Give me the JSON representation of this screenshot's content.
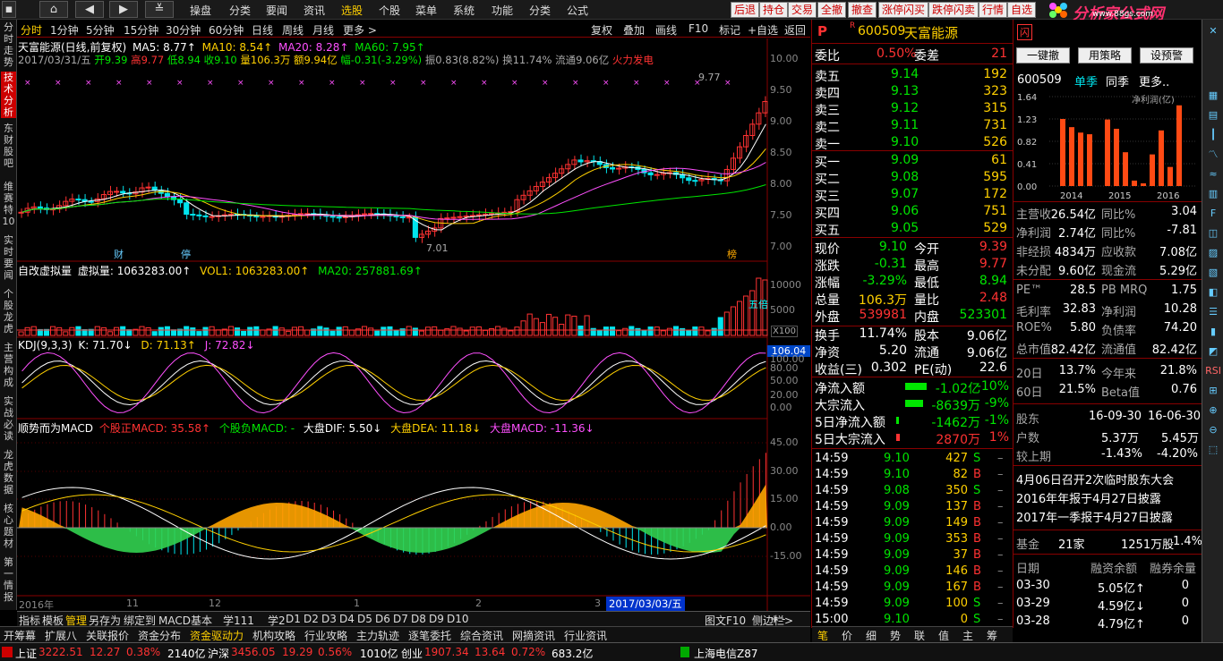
{
  "menubar": {
    "nav_icons": [
      "home-icon",
      "back-icon",
      "forward-icon",
      "menu-fold-icon"
    ],
    "items": [
      "操盘",
      "分类",
      "要闻",
      "资讯",
      "选股",
      "个股",
      "菜单",
      "系统",
      "功能",
      "分类",
      "公式"
    ],
    "active_index": 4,
    "quick_buttons": [
      "后退",
      "持仓",
      "交易",
      "全撤",
      "撤查",
      "涨停闪买",
      "跌停闪卖",
      "行情",
      "自选"
    ],
    "logo_text": "分析家公式网",
    "logo_url": "www.88gs.com"
  },
  "leftbar": [
    "分时走势",
    "技术分析",
    "东财股吧",
    "维赛特10",
    "实时要闻",
    "个股龙虎",
    "主营构成",
    "实战必读",
    "龙虎数据",
    "核心题材",
    "第一情报"
  ],
  "leftbar_active": 1,
  "periodbar": {
    "tabs": [
      "分时",
      "1分钟",
      "5分钟",
      "15分钟",
      "30分钟",
      "60分钟",
      "日线",
      "周线",
      "月线",
      "更多 >"
    ],
    "active_index": 0,
    "tools": [
      "复权",
      "叠加",
      "画线",
      "F10",
      "标记",
      "+自选",
      "返回"
    ]
  },
  "kline": {
    "title": "天富能源(日线,前复权)",
    "ma5": "MA5: 8.77↑",
    "ma10": "MA10: 8.54↑",
    "ma20": "MA20: 8.28↑",
    "ma60": "MA60: 7.95↑",
    "info_date": "2017/03/31/五",
    "info_open": "开9.39",
    "info_high": "高9.77",
    "info_low": "低8.94",
    "info_close": "收9.10",
    "info_vol": "量106.3万",
    "info_amt": "额9.94亿",
    "info_chg": "幅-0.31(-3.29%)",
    "info_amp": "振0.83(8.82%)",
    "info_turn": "换11.74%",
    "info_float": "流通9.06亿",
    "info_concept": "火力发电",
    "high_label": "9.77",
    "low_label": "7.01",
    "mark_cai": "财",
    "mark_ting": "停",
    "mark_bang": "榜",
    "yticks": [
      "10.00",
      "9.50",
      "9.00",
      "8.50",
      "8.00",
      "7.50",
      "7.00"
    ]
  },
  "vol": {
    "title": "自改虚拟量",
    "virtual": "虚拟量: 1063283.00↑",
    "vol1": "VOL1: 1063283.00↑",
    "ma20": "MA20: 257881.69↑",
    "yticks": [
      "10000",
      "5000"
    ],
    "unit": "X100",
    "marker": "五倍",
    "side_value": "106.04"
  },
  "kdj": {
    "title": "KDJ(9,3,3)",
    "k": "K: 71.70↓",
    "d": "D: 71.13↑",
    "j": "J: 72.82↓",
    "yticks": [
      "100.00",
      "80.00",
      "50.00",
      "20.00",
      "0.00"
    ]
  },
  "macd": {
    "title": "顺势而为MACD",
    "stock_pos": "个股正MACD: 35.58↑",
    "stock_neg": "个股负MACD: -",
    "dif": "大盘DIF: 5.50↓",
    "dea": "大盘DEA: 11.18↓",
    "mmacd": "大盘MACD: -11.36↓",
    "yticks": [
      "45.00",
      "30.00",
      "15.00",
      "0.00",
      "-15.00"
    ]
  },
  "xaxis": {
    "labels": [
      "2016年",
      "11",
      "12",
      "1",
      "2",
      "3"
    ],
    "cursor": "2017/03/03/五"
  },
  "bottom_tabs": [
    "指标",
    "模板",
    "管理",
    "另存为",
    "绑定到",
    "MACD基本",
    "学111",
    "学2",
    "D1",
    "D2",
    "D3",
    "D4",
    "D5",
    "D6",
    "D7",
    "D8",
    "D9",
    "D10"
  ],
  "bottom_tabs_active": 2,
  "bottom_right": [
    "+",
    "-",
    "图文F10",
    "侧边栏>"
  ],
  "bottom_tabs2": [
    "开筹幕",
    "扩展八",
    "关联报价",
    "资金分布",
    "资金驱动力",
    "机构攻略",
    "行业攻略",
    "主力轨迹",
    "逐笔委托",
    "综合资讯",
    "网摘资讯",
    "行业资讯"
  ],
  "bottom_tabs2_active": 4,
  "status": {
    "sh_label": "上证",
    "sh_val": "3222.51",
    "sh_chg": "12.27",
    "sh_pct": "0.38%",
    "sh_amt": "2140亿",
    "sz_label": "沪深",
    "sz_val": "3456.05",
    "sz_chg": "19.29",
    "sz_pct": "0.56%",
    "sz_amt": "1010亿",
    "cy_label": "创业",
    "cy_val": "1907.34",
    "cy_chg": "13.64",
    "cy_pct": "0.72%",
    "cy_amt": "683.2亿",
    "net": "上海电信Z87"
  },
  "quote": {
    "p_mark": "P",
    "r_mark": "R",
    "code": "600509",
    "name": "天富能源",
    "wb_label": "委比",
    "wb": "0.50%",
    "wc_label": "委差",
    "wc": "21",
    "asks": [
      [
        "卖五",
        "9.14",
        "192"
      ],
      [
        "卖四",
        "9.13",
        "323"
      ],
      [
        "卖三",
        "9.12",
        "315"
      ],
      [
        "卖二",
        "9.11",
        "731"
      ],
      [
        "卖一",
        "9.10",
        "526"
      ]
    ],
    "bids": [
      [
        "买一",
        "9.09",
        "61"
      ],
      [
        "买二",
        "9.08",
        "595"
      ],
      [
        "买三",
        "9.07",
        "172"
      ],
      [
        "买四",
        "9.06",
        "751"
      ],
      [
        "买五",
        "9.05",
        "529"
      ]
    ],
    "stats": [
      [
        "现价",
        "9.10",
        "今开",
        "9.39"
      ],
      [
        "涨跌",
        "-0.31",
        "最高",
        "9.77"
      ],
      [
        "涨幅",
        "-3.29%",
        "最低",
        "8.94"
      ],
      [
        "总量",
        "106.3万",
        "量比",
        "2.48"
      ],
      [
        "外盘",
        "539981",
        "内盘",
        "523301"
      ]
    ],
    "stats2": [
      [
        "换手",
        "11.74%",
        "股本",
        "9.06亿"
      ],
      [
        "净资",
        "5.20",
        "流通",
        "9.06亿"
      ],
      [
        "收益(三)",
        "0.302",
        "PE(动)",
        "22.6"
      ]
    ],
    "flows": [
      [
        "净流入额",
        "-1.02亿",
        "-10%"
      ],
      [
        "大宗流入",
        "-8639万",
        "-9%"
      ],
      [
        "5日净流入额",
        "-1462万",
        "-1%"
      ],
      [
        "5日大宗流入",
        "2870万",
        "1%"
      ]
    ],
    "ticks": [
      [
        "14:59",
        "9.10",
        "427",
        "S"
      ],
      [
        "14:59",
        "9.10",
        "82",
        "B"
      ],
      [
        "14:59",
        "9.08",
        "350",
        "S"
      ],
      [
        "14:59",
        "9.09",
        "137",
        "B"
      ],
      [
        "14:59",
        "9.09",
        "149",
        "B"
      ],
      [
        "14:59",
        "9.09",
        "353",
        "B"
      ],
      [
        "14:59",
        "9.09",
        "37",
        "B"
      ],
      [
        "14:59",
        "9.09",
        "146",
        "B"
      ],
      [
        "14:59",
        "9.09",
        "167",
        "B"
      ],
      [
        "14:59",
        "9.09",
        "100",
        "S"
      ],
      [
        "15:00",
        "9.10",
        "0",
        "S"
      ]
    ],
    "tabs": [
      "笔",
      "价",
      "细",
      "势",
      "联",
      "值",
      "主",
      "筹"
    ]
  },
  "f10": {
    "tabs": [
      "闪"
    ],
    "buttons": [
      "一键撤",
      "用策略",
      "设预警"
    ],
    "code": "600509",
    "mode1": "单季",
    "mode2": "同季",
    "more": "更多..",
    "chart_label": "净利润(亿)",
    "yticks": [
      "1.64",
      "1.23",
      "0.82",
      "0.41",
      "0.00"
    ],
    "years": [
      "2014",
      "2015",
      "2016"
    ],
    "rows": [
      [
        "主营收",
        "26.54亿",
        "同比%",
        "3.04"
      ],
      [
        "净利润",
        "2.74亿",
        "同比%",
        "-7.81"
      ],
      [
        "非经损",
        "4834万",
        "应收款",
        "7.08亿"
      ],
      [
        "未分配",
        "9.60亿",
        "现金流",
        "5.29亿"
      ]
    ],
    "rows2": [
      [
        "PE™",
        "28.5",
        "PB MRQ",
        "1.75"
      ],
      [
        "毛利率",
        "32.83",
        "净利润",
        "10.28"
      ],
      [
        "ROE%",
        "5.80",
        "负债率",
        "74.20"
      ],
      [
        "总市值",
        "82.42亿",
        "流通值",
        "82.42亿"
      ]
    ],
    "rows3": [
      [
        "20日",
        "13.7%",
        "今年来",
        "21.8%"
      ],
      [
        "60日",
        "21.5%",
        "Beta值",
        "0.76"
      ]
    ],
    "holders_label": "股东",
    "holders_d1": "16-09-30",
    "holders_d2": "16-06-30",
    "hu_label": "户数",
    "hu_v1": "5.37万",
    "hu_v2": "5.45万",
    "hq_label": "较上期",
    "hq_v1": "-1.43%",
    "hq_v2": "-4.20%",
    "notes": [
      "4月06日召开2次临时股东大会",
      "2016年年报于4月27日披露",
      "2017年一季报于4月27日披露"
    ],
    "fund_label": "基金",
    "fund_n": "21家",
    "fund_amt": "1251万股",
    "fund_pct": "1.4%",
    "margin_head": [
      "日期",
      "融资余额",
      "融券余量"
    ],
    "margin": [
      [
        "03-30",
        "5.05亿↑",
        "0"
      ],
      [
        "03-29",
        "4.59亿↓",
        "0"
      ],
      [
        "03-28",
        "4.79亿↑",
        "0"
      ]
    ]
  },
  "chart_data": {
    "type": "bar",
    "title": "净利润(亿)",
    "categories": [
      "2014",
      "2015",
      "2016"
    ],
    "series": [
      {
        "values": [
          1.23,
          1.08,
          0.98,
          0.95,
          0.0,
          1.22,
          1.05,
          0.62,
          0.1,
          0.05,
          0.58,
          1.02,
          0.35,
          1.48,
          0.0
        ]
      }
    ],
    "ylim": [
      0,
      1.64
    ],
    "yticks": [
      0,
      0.41,
      0.82,
      1.23,
      1.64
    ]
  },
  "colors": {
    "up": "#ff3232",
    "down": "#00e5ee",
    "ma5": "#ffffff",
    "ma10": "#ffd000",
    "ma20": "#ff50ff",
    "ma60": "#00e600",
    "macd_pos": "#ffa500",
    "macd_neg": "#32d250"
  }
}
